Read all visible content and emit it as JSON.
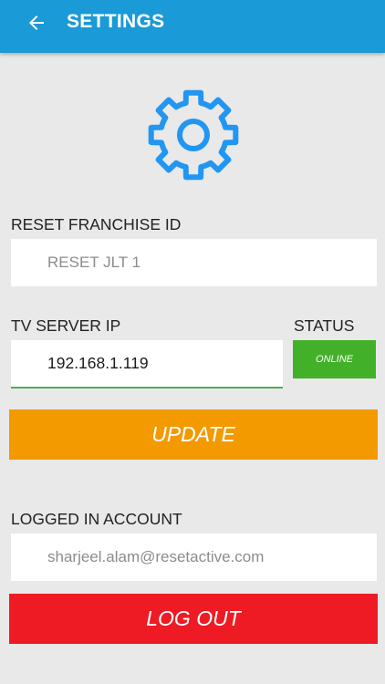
{
  "header": {
    "title": "SETTINGS",
    "back_icon": "arrow-left-icon"
  },
  "hero_icon": "gear-icon",
  "franchise": {
    "label": "RESET FRANCHISE ID",
    "value": "RESET JLT 1"
  },
  "server": {
    "label": "TV SERVER IP",
    "value": "192.168.1.119"
  },
  "status": {
    "label": "STATUS",
    "value": "ONLINE"
  },
  "update_button": "UPDATE",
  "account": {
    "label": "LOGGED IN ACCOUNT",
    "value": "sharjeel.alam@resetactive.com"
  },
  "logout_button": "LOG OUT",
  "colors": {
    "appbar": "#1a9ad6",
    "gear": "#2196f3",
    "status_online": "#43b02a",
    "update": "#f39a00",
    "logout": "#ee1b24",
    "input_focus": "#4caf50"
  }
}
